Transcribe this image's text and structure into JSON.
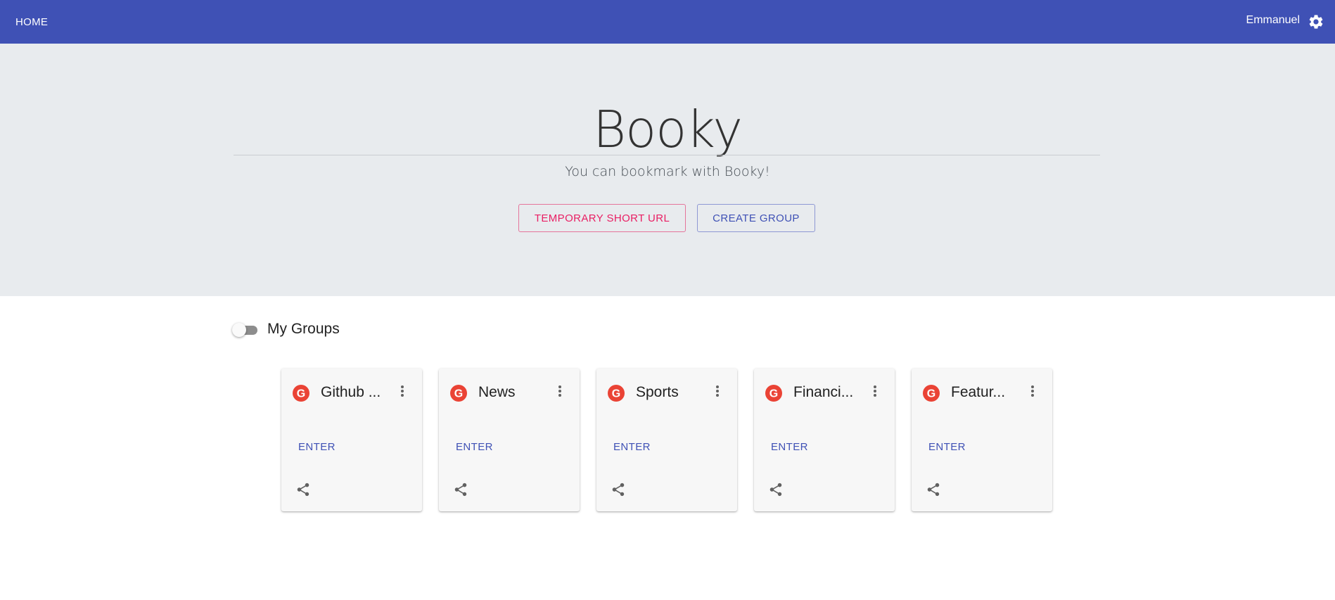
{
  "appbar": {
    "home_label": "HOME",
    "user_name": "Emmanuel",
    "settings_icon": "gear-icon",
    "background": "#3f51b5"
  },
  "hero": {
    "title": "Booky",
    "subtitle": "You can bookmark with Booky!",
    "temp_url_label": "TEMPORARY SHORT URL",
    "create_group_label": "CREATE GROUP"
  },
  "groups": {
    "toggle_label": "My Groups",
    "toggle_on": false,
    "cards": [
      {
        "title": "Github ...",
        "enter_label": "ENTER",
        "icon": "google-icon"
      },
      {
        "title": "News",
        "enter_label": "ENTER",
        "icon": "google-icon"
      },
      {
        "title": "Sports",
        "enter_label": "ENTER",
        "icon": "google-icon"
      },
      {
        "title": "Financi...",
        "enter_label": "ENTER",
        "icon": "google-icon"
      },
      {
        "title": "Featur...",
        "enter_label": "ENTER",
        "icon": "google-icon"
      }
    ]
  },
  "colors": {
    "accent_pink": "#e91e63",
    "accent_indigo": "#3f51b5",
    "hero_bg": "#e8ebee",
    "google_red": "#ea4335"
  }
}
